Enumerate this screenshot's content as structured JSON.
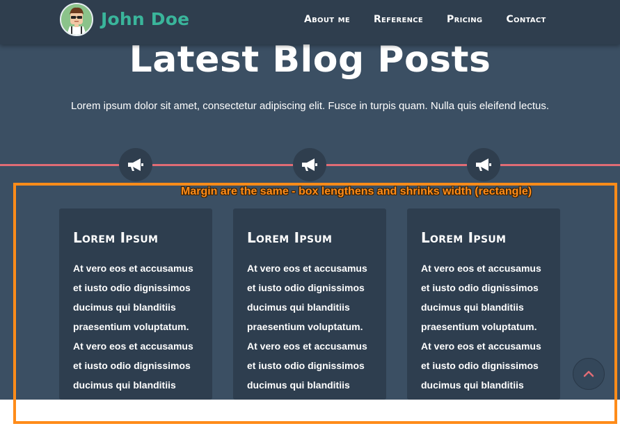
{
  "brand": {
    "name": "John Doe",
    "accent_color": "#3ab59b",
    "avatar_icon": "avatar-icon"
  },
  "nav": {
    "items": [
      {
        "label": "About me"
      },
      {
        "label": "Reference"
      },
      {
        "label": "Pricing"
      },
      {
        "label": "Contact"
      }
    ]
  },
  "hero": {
    "title": "Latest Blog Posts",
    "subtitle": "Lorem ipsum dolor sit amet, consectetur adipiscing elit. Fusce in turpis quam. Nulla quis eleifend lectus."
  },
  "timeline": {
    "line_color": "#e06c75",
    "icon": "megaphone-icon"
  },
  "cards": [
    {
      "title": "Lorem Ipsum",
      "body": "At vero eos et accusamus et iusto odio dignissimos ducimus qui blanditiis praesentium voluptatum. At vero eos et accusamus et iusto odio dignissimos ducimus qui blanditiis praesentium voluptatum."
    },
    {
      "title": "Lorem Ipsum",
      "body": "At vero eos et accusamus et iusto odio dignissimos ducimus qui blanditiis praesentium voluptatum. At vero eos et accusamus et iusto odio dignissimos ducimus qui blanditiis praesentium voluptatum."
    },
    {
      "title": "Lorem Ipsum",
      "body": "At vero eos et accusamus et iusto odio dignissimos ducimus qui blanditiis praesentium voluptatum. At vero eos et accusamus et iusto odio dignissimos ducimus qui blanditiis praesentium voluptatum."
    }
  ],
  "scroll_top": {
    "icon": "chevron-up-icon"
  },
  "annotation": {
    "text": "Margin are the same - box lengthens and shrinks width (rectangle)",
    "color": "#ff8c1a"
  },
  "colors": {
    "background": "#3b4f63",
    "navbar": "#2f3e4e",
    "card": "#2e3e4f"
  }
}
